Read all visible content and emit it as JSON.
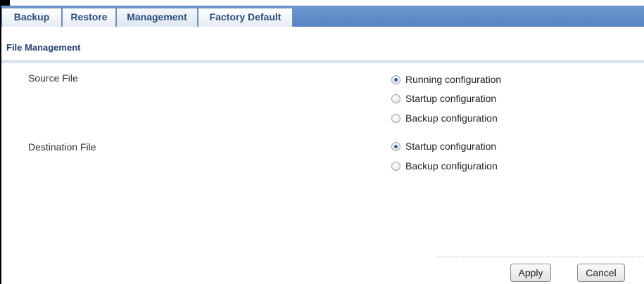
{
  "tabs": [
    {
      "label": "Backup",
      "active": false
    },
    {
      "label": "Restore",
      "active": false
    },
    {
      "label": "Management",
      "active": true
    },
    {
      "label": "Factory Default",
      "active": false
    }
  ],
  "section": {
    "title": "File Management"
  },
  "source_file": {
    "label": "Source File",
    "options": [
      {
        "label": "Running configuration",
        "checked": true
      },
      {
        "label": "Startup configuration",
        "checked": false
      },
      {
        "label": "Backup configuration",
        "checked": false
      }
    ]
  },
  "destination_file": {
    "label": "Destination File",
    "options": [
      {
        "label": "Startup configuration",
        "checked": true
      },
      {
        "label": "Backup configuration",
        "checked": false
      }
    ]
  },
  "buttons": {
    "apply": "Apply",
    "cancel": "Cancel"
  },
  "colors": {
    "tab_bar": "#5f8dc9",
    "tab_text": "#2b4d80",
    "section_title": "#233f6e",
    "radio_dot": "#2f5fa8"
  }
}
